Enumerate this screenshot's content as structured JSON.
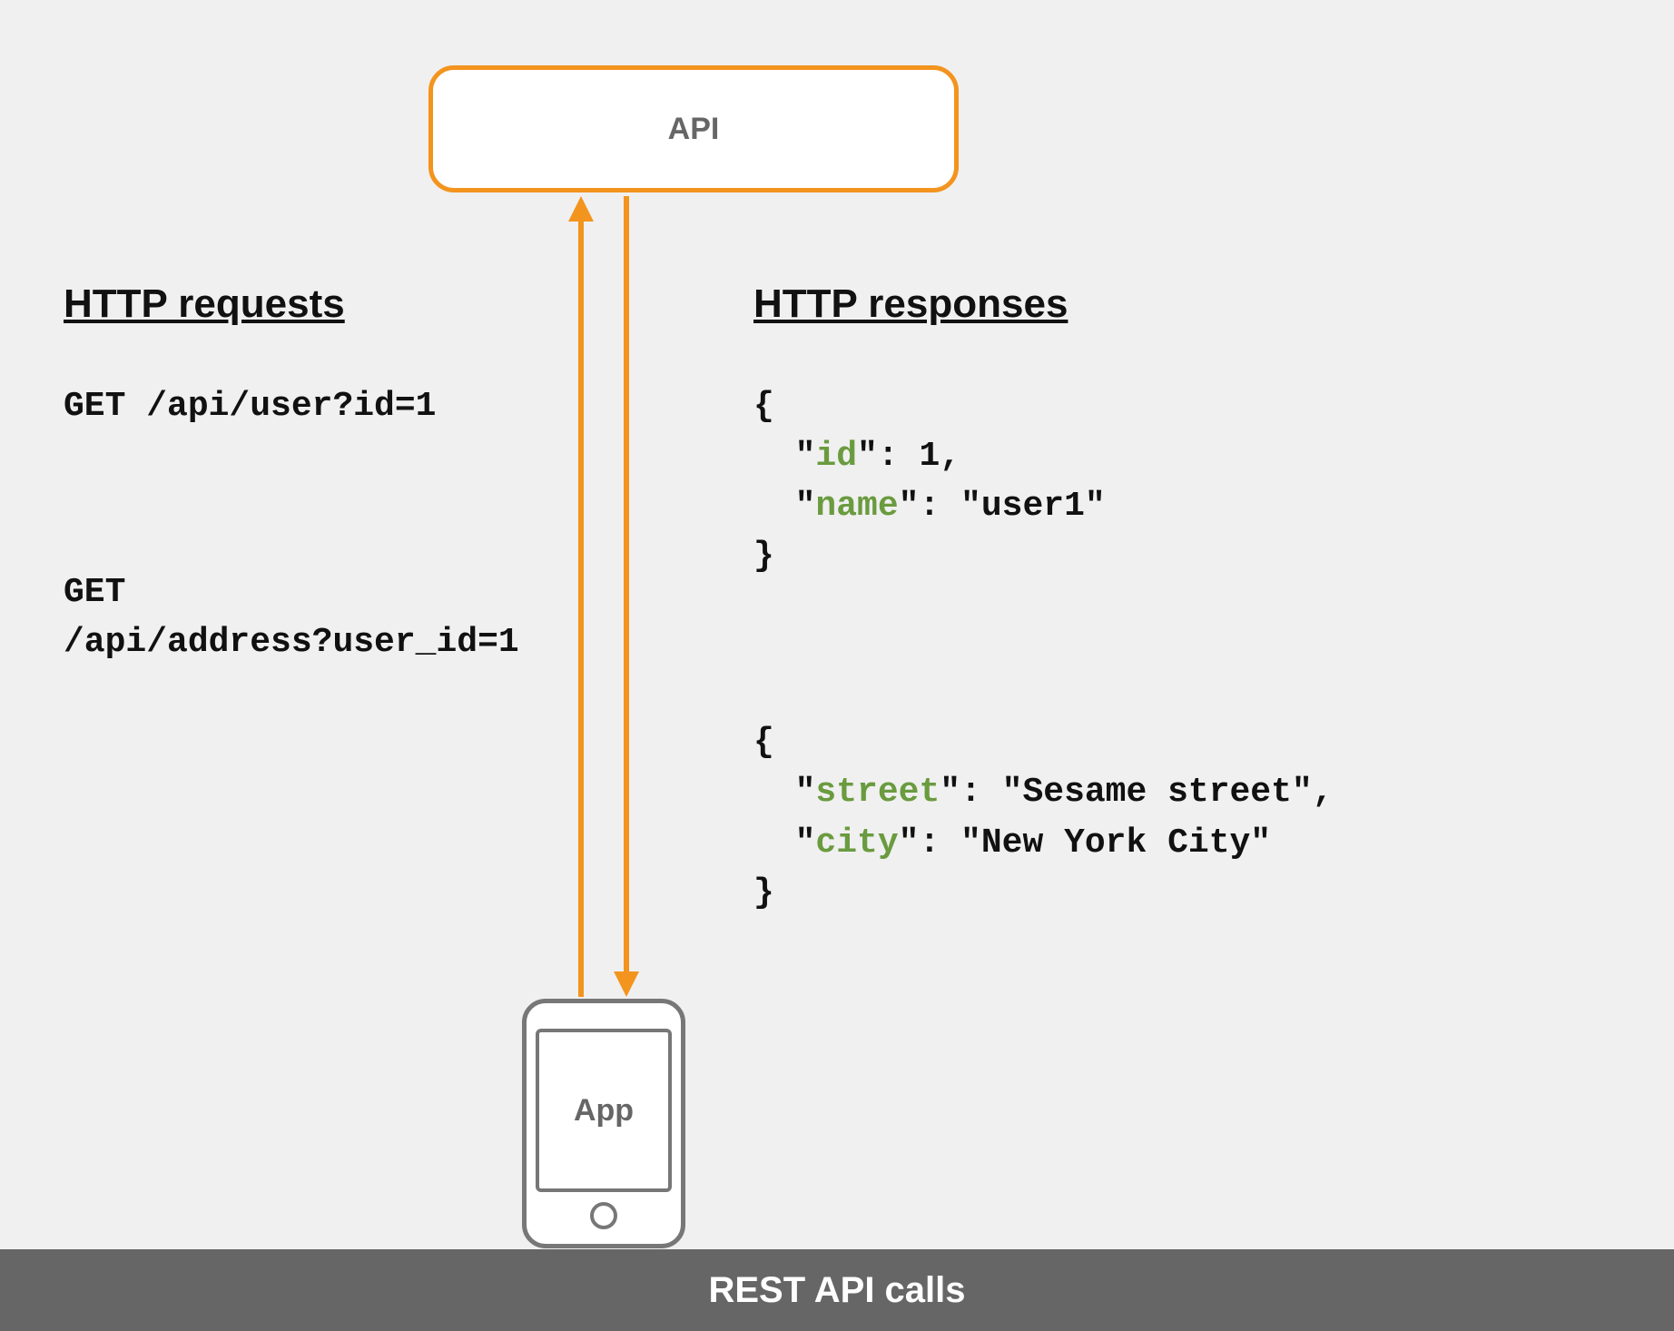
{
  "api_box": {
    "label": "API"
  },
  "app_box": {
    "label": "App"
  },
  "headers": {
    "requests": "HTTP requests",
    "responses": "HTTP responses"
  },
  "requests": {
    "r1": "GET /api/user?id=1",
    "r2_line1": "GET",
    "r2_line2": "/api/address?user_id=1"
  },
  "responses": {
    "r1": {
      "open": "{",
      "id_key": "id",
      "id_sep": "\"",
      "id_line_prefix": "  \"",
      "id_line_suffix": "\": 1,",
      "name_key": "name",
      "name_line_prefix": "  \"",
      "name_line_suffix": "\": \"user1\"",
      "close": "}"
    },
    "r2": {
      "open": "{",
      "street_key": "street",
      "street_line_prefix": "  \"",
      "street_line_suffix": "\": \"Sesame street\",",
      "city_key": "city",
      "city_line_prefix": "  \"",
      "city_line_suffix": "\": \"New York City\"",
      "close": "}"
    }
  },
  "footer": {
    "title": "REST API calls"
  },
  "colors": {
    "accent": "#f3941e",
    "json_key": "#6a9b3f",
    "footer_bg": "#666666"
  }
}
